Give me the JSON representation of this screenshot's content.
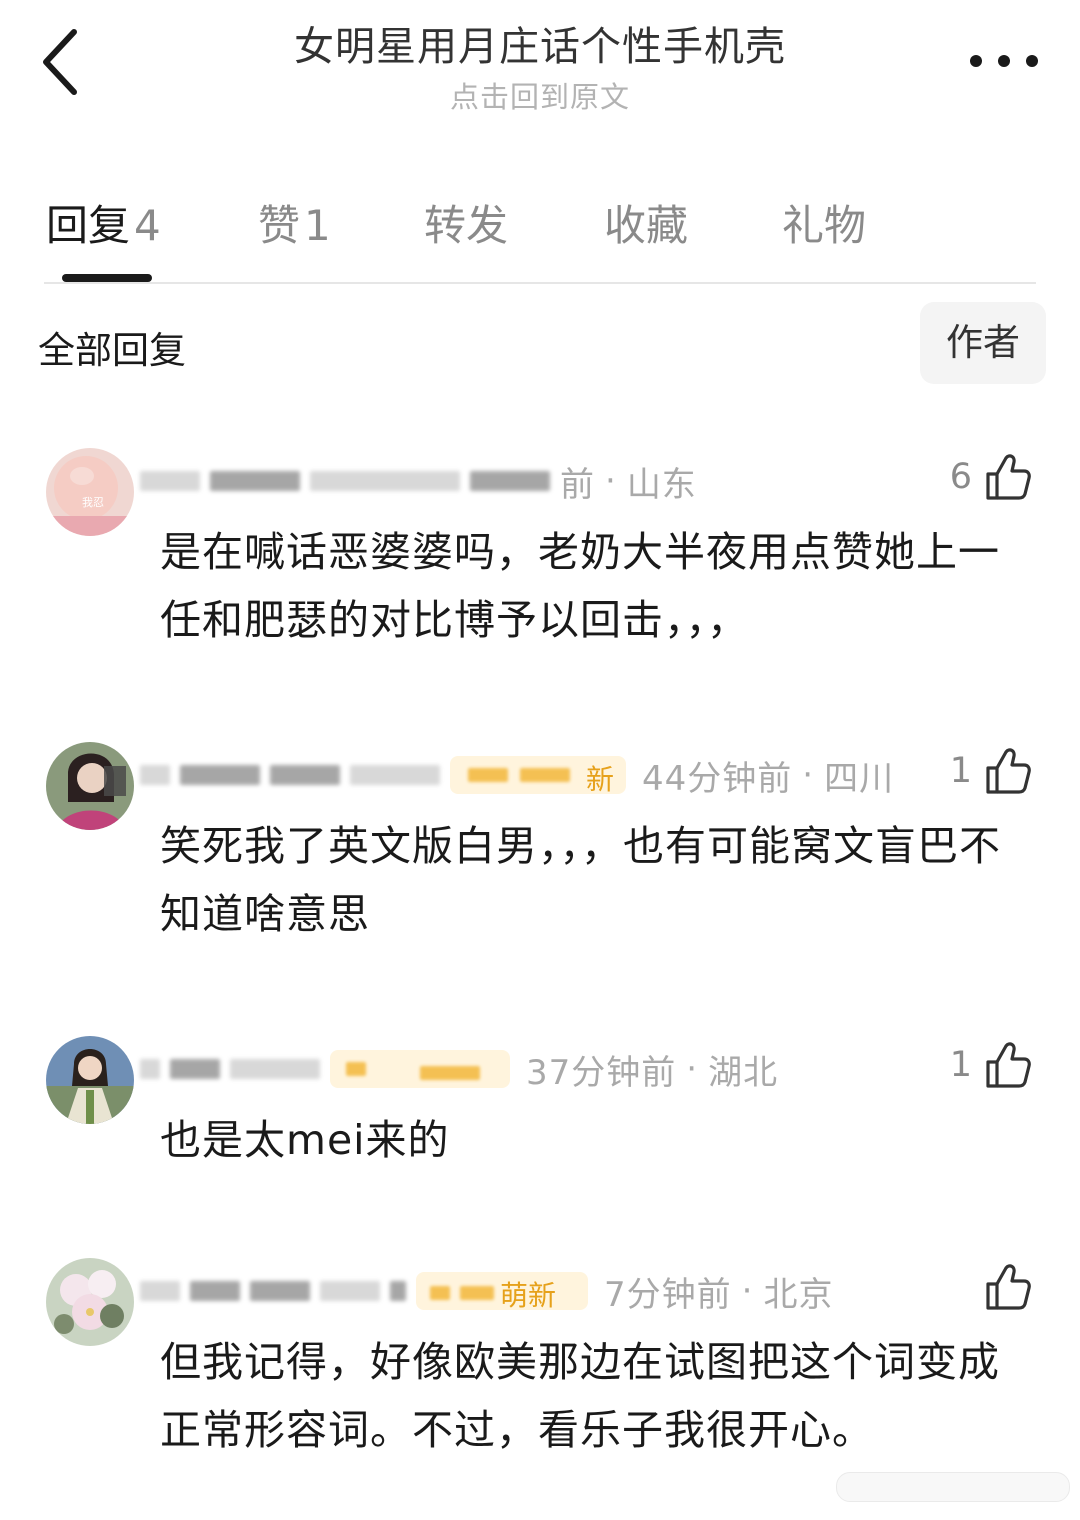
{
  "header": {
    "title": "女明星用月庄话个性手机壳",
    "subtitle": "点击回到原文"
  },
  "tabs": [
    {
      "label": "回复",
      "count": "4"
    },
    {
      "label": "赞",
      "count": "1"
    },
    {
      "label": "转发",
      "count": ""
    },
    {
      "label": "收藏",
      "count": ""
    },
    {
      "label": "礼物",
      "count": ""
    }
  ],
  "filter": {
    "label": "全部回复",
    "author_button": "作者"
  },
  "comments": [
    {
      "time": "前",
      "location": "山东",
      "likes": "6",
      "text": "是在喊话恶婆婆吗，老奶大半夜用点赞她上一任和肥瑟的对比博予以回击，，，",
      "avatar_text": "我忍"
    },
    {
      "time": "44分钟前",
      "location": "四川",
      "likes": "1",
      "text": "笑死我了英文版白男，，，也有可能窝文盲巴不知道啥意思",
      "badge_text": "新"
    },
    {
      "time": "37分钟前",
      "location": "湖北",
      "likes": "1",
      "text": "也是太mei来的",
      "badge_text": ""
    },
    {
      "time": "7分钟前",
      "location": "北京",
      "likes": "",
      "text": "但我记得，好像欧美那边在试图把这个词变成正常形容词。不过，看乐子我很开心。",
      "badge_text": "萌新"
    }
  ],
  "colors": {
    "primary_text": "#1a1a1a",
    "secondary_text": "#a9a9a9",
    "badge_bg": "#fff4dd",
    "badge_fg": "#e6a11b"
  },
  "icons": [
    "back-chevron-icon",
    "more-dots-icon",
    "thumbs-up-icon"
  ]
}
